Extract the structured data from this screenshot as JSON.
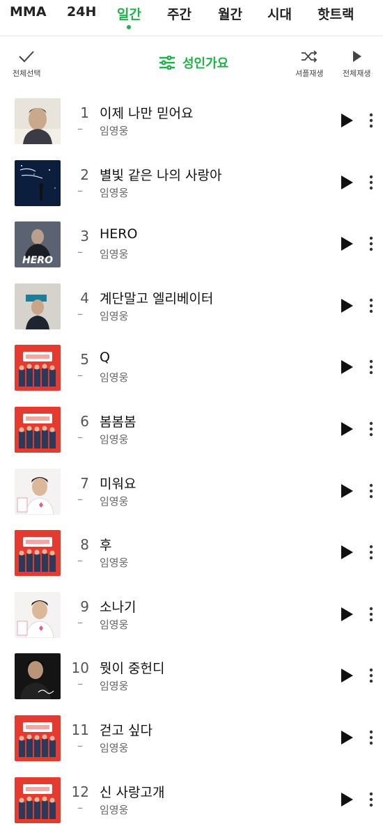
{
  "tabs": [
    {
      "label": "MMA",
      "active": false
    },
    {
      "label": "24H",
      "active": false
    },
    {
      "label": "일간",
      "active": true
    },
    {
      "label": "주간",
      "active": false
    },
    {
      "label": "월간",
      "active": false
    },
    {
      "label": "시대",
      "active": false
    },
    {
      "label": "핫트랙",
      "active": false
    }
  ],
  "toolbar": {
    "select_all_label": "전체선택",
    "filter_label": "성인가요",
    "shuffle_label": "셔플재생",
    "play_all_label": "전체재생"
  },
  "colors": {
    "accent": "#1fb14a"
  },
  "songs": [
    {
      "rank": "1",
      "title": "이제 나만 믿어요",
      "artist": "임영웅",
      "dash": "–",
      "art_style": "studio"
    },
    {
      "rank": "2",
      "title": "별빛 같은 나의 사랑아",
      "artist": "임영웅",
      "dash": "–",
      "art_style": "night"
    },
    {
      "rank": "3",
      "title": "HERO",
      "artist": "임영웅",
      "dash": "–",
      "art_style": "hero",
      "art_text": "HERO"
    },
    {
      "rank": "4",
      "title": "계단말고 엘리베이터",
      "artist": "임영웅",
      "dash": "–",
      "art_style": "elevator"
    },
    {
      "rank": "5",
      "title": "Q",
      "artist": "임영웅",
      "dash": "–",
      "art_style": "red"
    },
    {
      "rank": "6",
      "title": "봄봄봄",
      "artist": "임영웅",
      "dash": "–",
      "art_style": "red"
    },
    {
      "rank": "7",
      "title": "미워요",
      "artist": "임영웅",
      "dash": "–",
      "art_style": "white"
    },
    {
      "rank": "8",
      "title": "후",
      "artist": "임영웅",
      "dash": "–",
      "art_style": "red"
    },
    {
      "rank": "9",
      "title": "소나기",
      "artist": "임영웅",
      "dash": "–",
      "art_style": "white"
    },
    {
      "rank": "10",
      "title": "뭣이 중헌디",
      "artist": "임영웅",
      "dash": "–",
      "art_style": "dark"
    },
    {
      "rank": "11",
      "title": "걷고 싶다",
      "artist": "임영웅",
      "dash": "–",
      "art_style": "red"
    },
    {
      "rank": "12",
      "title": "신 사랑고개",
      "artist": "임영웅",
      "dash": "–",
      "art_style": "red"
    }
  ]
}
